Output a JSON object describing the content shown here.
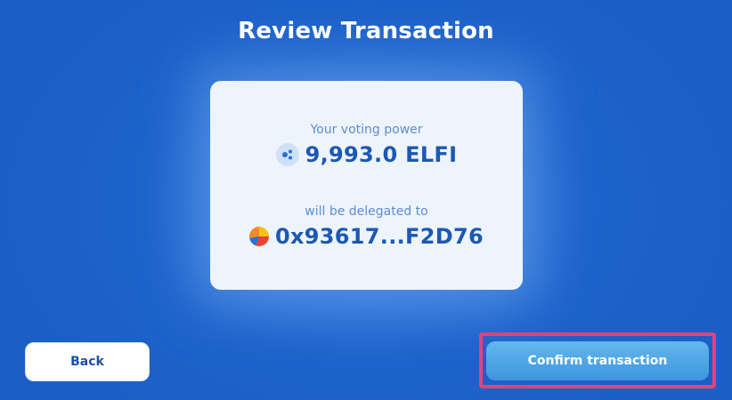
{
  "page": {
    "title": "Review Transaction"
  },
  "summary": {
    "voting_power_label": "Your voting power",
    "voting_power_value": "9,993.0 ELFI",
    "voting_power_icon": "elfi-token-icon",
    "delegate_label": "will be delegated to",
    "delegate_address": "0x93617...F2D76",
    "delegate_icon": "wallet-avatar-icon"
  },
  "actions": {
    "back_label": "Back",
    "confirm_label": "Confirm transaction"
  },
  "colors": {
    "background": "#1d63cc",
    "card": "#eef4fc",
    "value_text": "#1c58b4",
    "label_text": "#5b8ed2",
    "confirm_button": "#4fa3e4",
    "highlight_border": "#e8407a"
  }
}
